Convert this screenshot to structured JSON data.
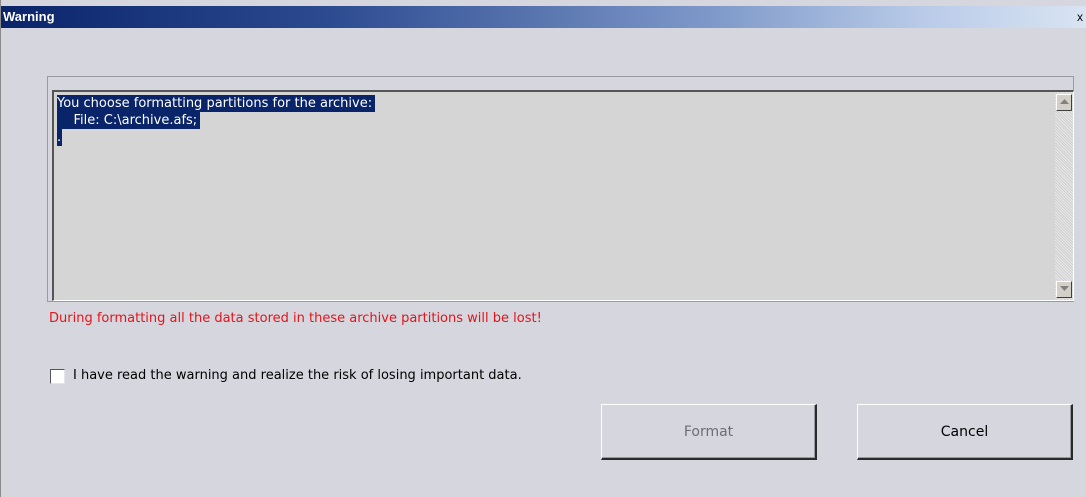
{
  "window": {
    "title": "Warning",
    "close_glyph": "x"
  },
  "message_box": {
    "lines": [
      "You choose formatting partitions for the archive:",
      "    File: C:\\archive.afs;",
      "."
    ]
  },
  "warning": {
    "text": "During formatting all the data stored in these archive partitions will be lost!",
    "color": "#e2151b"
  },
  "acknowledge": {
    "label": "I have read the warning and realize the risk of losing important data.",
    "checked": false
  },
  "buttons": {
    "format_label": "Format",
    "cancel_label": "Cancel"
  },
  "colors": {
    "title_bar_start": "#0a246a",
    "selection": "#0a246a",
    "dialog_bg": "#d6d6de"
  }
}
